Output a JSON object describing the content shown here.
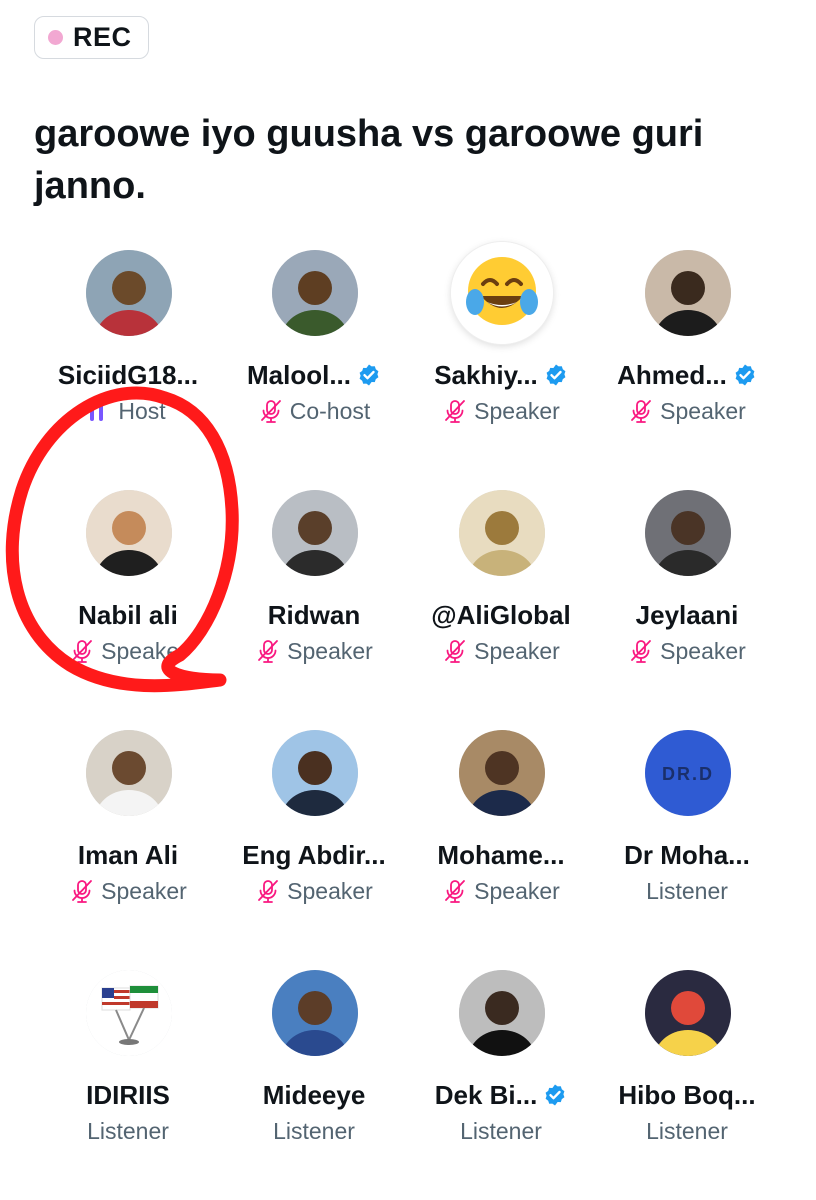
{
  "rec": {
    "label": "REC",
    "dot_color": "#f2a8d2"
  },
  "space": {
    "title": "garoowe iyo guusha vs garoowe guri janno."
  },
  "participants": [
    {
      "name": "SiciidG18...",
      "role": "Host",
      "verified": false,
      "role_icon": "speaking-bars-icon",
      "avatar": "avatar-photo"
    },
    {
      "name": "Malool...",
      "role": "Co-host",
      "verified": true,
      "role_icon": "muted-mic-icon",
      "avatar": "avatar-photo"
    },
    {
      "name": "Sakhiy...",
      "role": "Speaker",
      "verified": true,
      "role_icon": "muted-mic-icon",
      "avatar": "tears-of-joy-emoji"
    },
    {
      "name": "Ahmed...",
      "role": "Speaker",
      "verified": true,
      "role_icon": "muted-mic-icon",
      "avatar": "avatar-photo"
    },
    {
      "name": "Nabil ali",
      "role": "Speaker",
      "verified": false,
      "role_icon": "muted-mic-icon",
      "avatar": "avatar-photo"
    },
    {
      "name": "Ridwan",
      "role": "Speaker",
      "verified": false,
      "role_icon": "muted-mic-icon",
      "avatar": "avatar-photo"
    },
    {
      "name": "@AliGlobal",
      "role": "Speaker",
      "verified": false,
      "role_icon": "muted-mic-icon",
      "avatar": "avatar-photo"
    },
    {
      "name": "Jeylaani",
      "role": "Speaker",
      "verified": false,
      "role_icon": "muted-mic-icon",
      "avatar": "avatar-photo"
    },
    {
      "name": "Iman Ali",
      "role": "Speaker",
      "verified": false,
      "role_icon": "muted-mic-icon",
      "avatar": "avatar-photo"
    },
    {
      "name": "Eng Abdir...",
      "role": "Speaker",
      "verified": false,
      "role_icon": "muted-mic-icon",
      "avatar": "avatar-photo"
    },
    {
      "name": "Mohame...",
      "role": "Speaker",
      "verified": false,
      "role_icon": "muted-mic-icon",
      "avatar": "avatar-photo"
    },
    {
      "name": "Dr Moha...",
      "role": "Listener",
      "verified": false,
      "role_icon": "",
      "avatar": "avatar-logo"
    },
    {
      "name": "IDIRIIS",
      "role": "Listener",
      "verified": false,
      "role_icon": "",
      "avatar": "avatar-flags"
    },
    {
      "name": "Mideeye",
      "role": "Listener",
      "verified": false,
      "role_icon": "",
      "avatar": "avatar-photo"
    },
    {
      "name": "Dek Bi...",
      "role": "Listener",
      "verified": true,
      "role_icon": "",
      "avatar": "avatar-photo"
    },
    {
      "name": "Hibo Boq...",
      "role": "Listener",
      "verified": false,
      "role_icon": "",
      "avatar": "avatar-photo"
    }
  ],
  "colors": {
    "verified": "#1d9bf0",
    "muted_mic": "#f91880",
    "speaking": "#7856ff",
    "annotation": "#ff1a1a"
  }
}
